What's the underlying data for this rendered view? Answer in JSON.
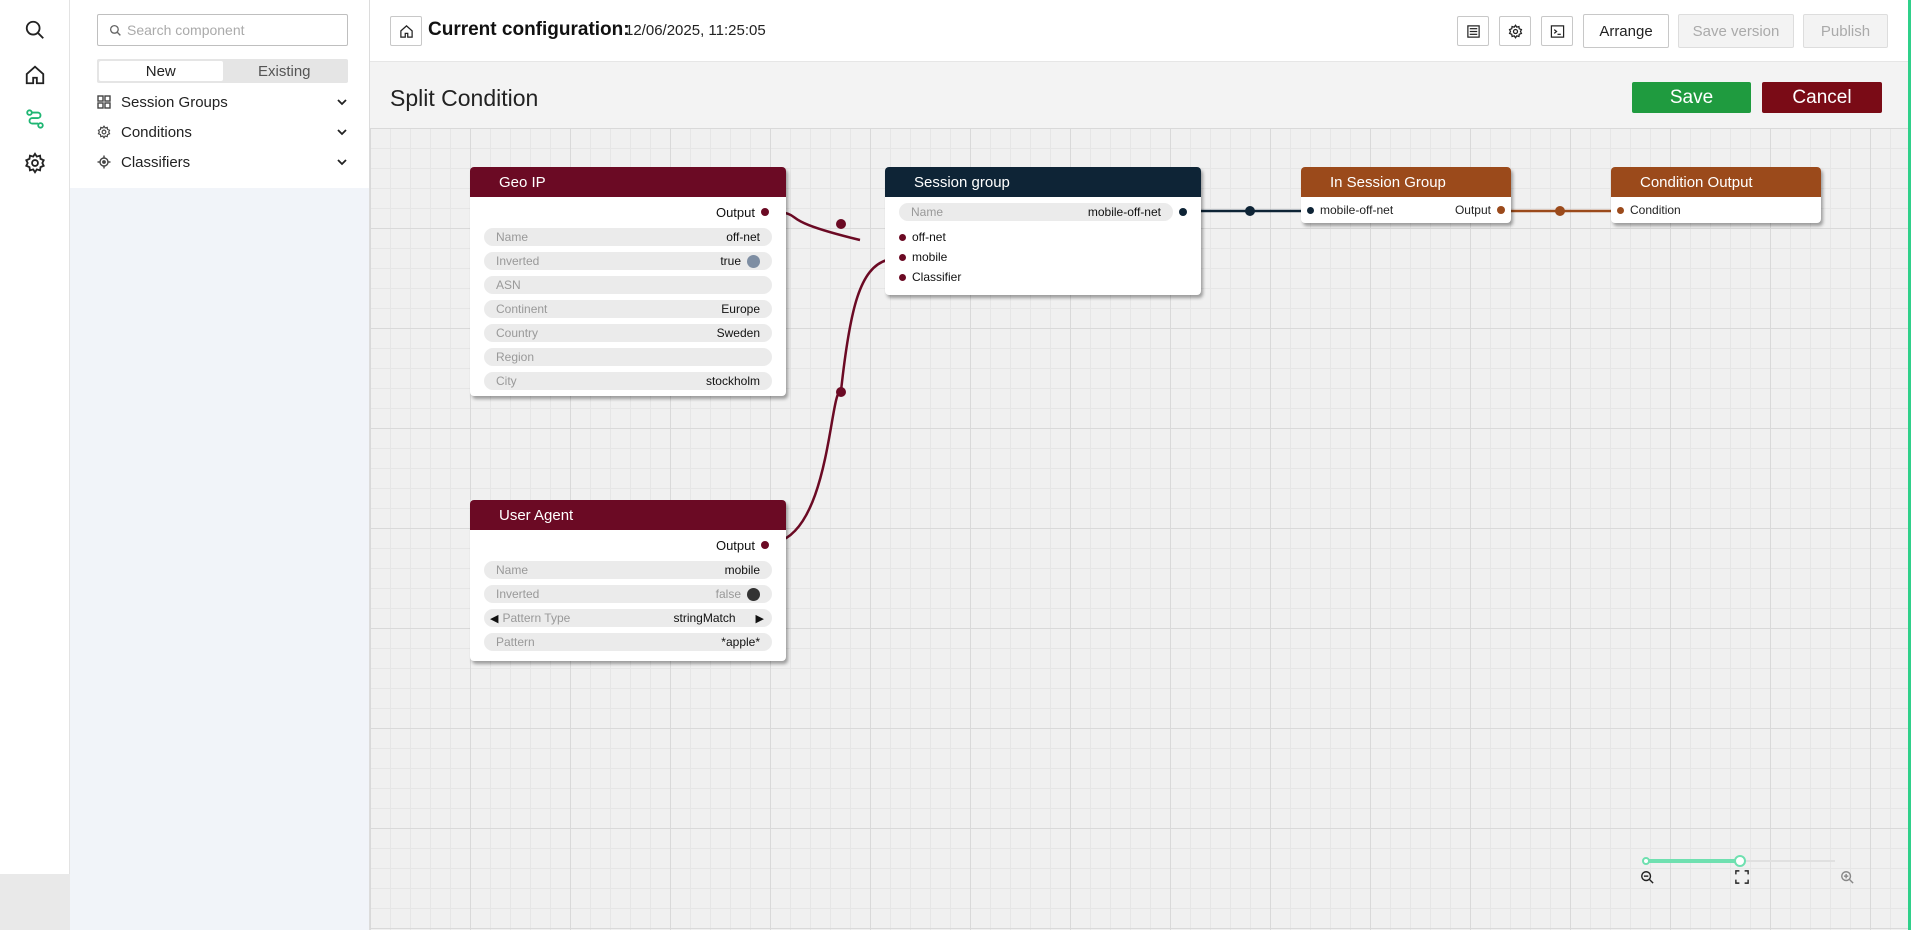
{
  "search": {
    "placeholder": "Search component"
  },
  "panel": {
    "tabs": [
      {
        "label": "New"
      },
      {
        "label": "Existing"
      }
    ],
    "categories": [
      {
        "label": "Session Groups"
      },
      {
        "label": "Conditions"
      },
      {
        "label": "Classifiers"
      }
    ]
  },
  "header": {
    "title": "Current configuration:",
    "date": "12/06/2025, 11:25:05",
    "arrange_label": "Arrange",
    "save_version_label": "Save version",
    "publish_label": "Publish"
  },
  "editor": {
    "title": "Split Condition",
    "save_label": "Save",
    "cancel_label": "Cancel"
  },
  "colors": {
    "condition_node": "#6b0a24",
    "session_group_node": "#0e2436",
    "in_session_group_node": "#9b4a1b",
    "condition_output_node": "#9b4a1b",
    "accent": "#2fd08a",
    "save": "#1f9b3f",
    "cancel": "#7a0b16"
  },
  "nodes": {
    "geo_ip": {
      "title": "Geo IP",
      "output": "Output",
      "props": [
        {
          "key": "Name",
          "value": "off-net"
        },
        {
          "key": "Inverted",
          "value": "true"
        },
        {
          "key": "ASN",
          "value": ""
        },
        {
          "key": "Continent",
          "value": "Europe"
        },
        {
          "key": "Country",
          "value": "Sweden"
        },
        {
          "key": "Region",
          "value": ""
        },
        {
          "key": "City",
          "value": "stockholm"
        }
      ]
    },
    "user_agent": {
      "title": "User Agent",
      "output": "Output",
      "props": [
        {
          "key": "Name",
          "value": "mobile"
        },
        {
          "key": "Inverted",
          "value": "false"
        },
        {
          "key": "Pattern Type",
          "value": "stringMatch"
        },
        {
          "key": "Pattern",
          "value": "*apple*"
        }
      ]
    },
    "session_group": {
      "title": "Session group",
      "name_key": "Name",
      "name_value": "mobile-off-net",
      "inputs": [
        "off-net",
        "mobile",
        "Classifier"
      ]
    },
    "in_session_group": {
      "title": "In Session Group",
      "input": "mobile-off-net",
      "output": "Output"
    },
    "condition_output": {
      "title": "Condition Output",
      "input": "Condition"
    }
  },
  "zoom": {
    "level": 0.5
  }
}
